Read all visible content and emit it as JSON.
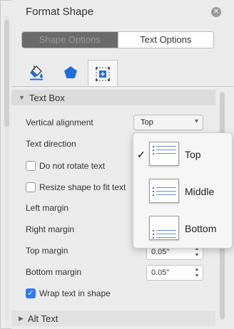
{
  "panel": {
    "title": "Format Shape",
    "close_glyph": "✕"
  },
  "segmented": {
    "left_label": "Shape Options",
    "right_label": "Text Options"
  },
  "icon_tabs": [
    {
      "icon": "fill-bucket-icon"
    },
    {
      "icon": "pentagon-effects-icon"
    },
    {
      "icon": "size-properties-icon"
    }
  ],
  "sections": {
    "text_box": {
      "toggle": "▼",
      "label": "Text Box"
    },
    "alt_text": {
      "toggle": "▶",
      "label": "Alt Text"
    }
  },
  "fields": {
    "vertical_alignment_label": "Vertical alignment",
    "vertical_alignment_value": "Top",
    "dropdown_chevron": "▾",
    "text_direction_label": "Text direction",
    "left_margin_label": "Left margin",
    "right_margin_label": "Right margin",
    "top_margin_label": "Top margin",
    "top_margin_value": "0.05\"",
    "bottom_margin_label": "Bottom margin",
    "bottom_margin_value": "0.05\"",
    "stepper_up": "▲",
    "stepper_down": "▼"
  },
  "checkboxes": {
    "do_not_rotate": {
      "label": "Do not rotate text",
      "checked": false
    },
    "resize_shape": {
      "label": "Resize shape to fit text",
      "checked": false
    },
    "wrap_text": {
      "label": "Wrap text in shape",
      "checked": true,
      "mark": "✓"
    }
  },
  "menu": {
    "items": [
      {
        "label": "Top",
        "selected": true,
        "check": "✓"
      },
      {
        "label": "Middle",
        "selected": false
      },
      {
        "label": "Bottom",
        "selected": false
      }
    ]
  },
  "colors": {
    "accent_blue": "#2e7cf6",
    "fill_icon_blue": "#1f6fdc",
    "panel_bg": "#ececec"
  }
}
